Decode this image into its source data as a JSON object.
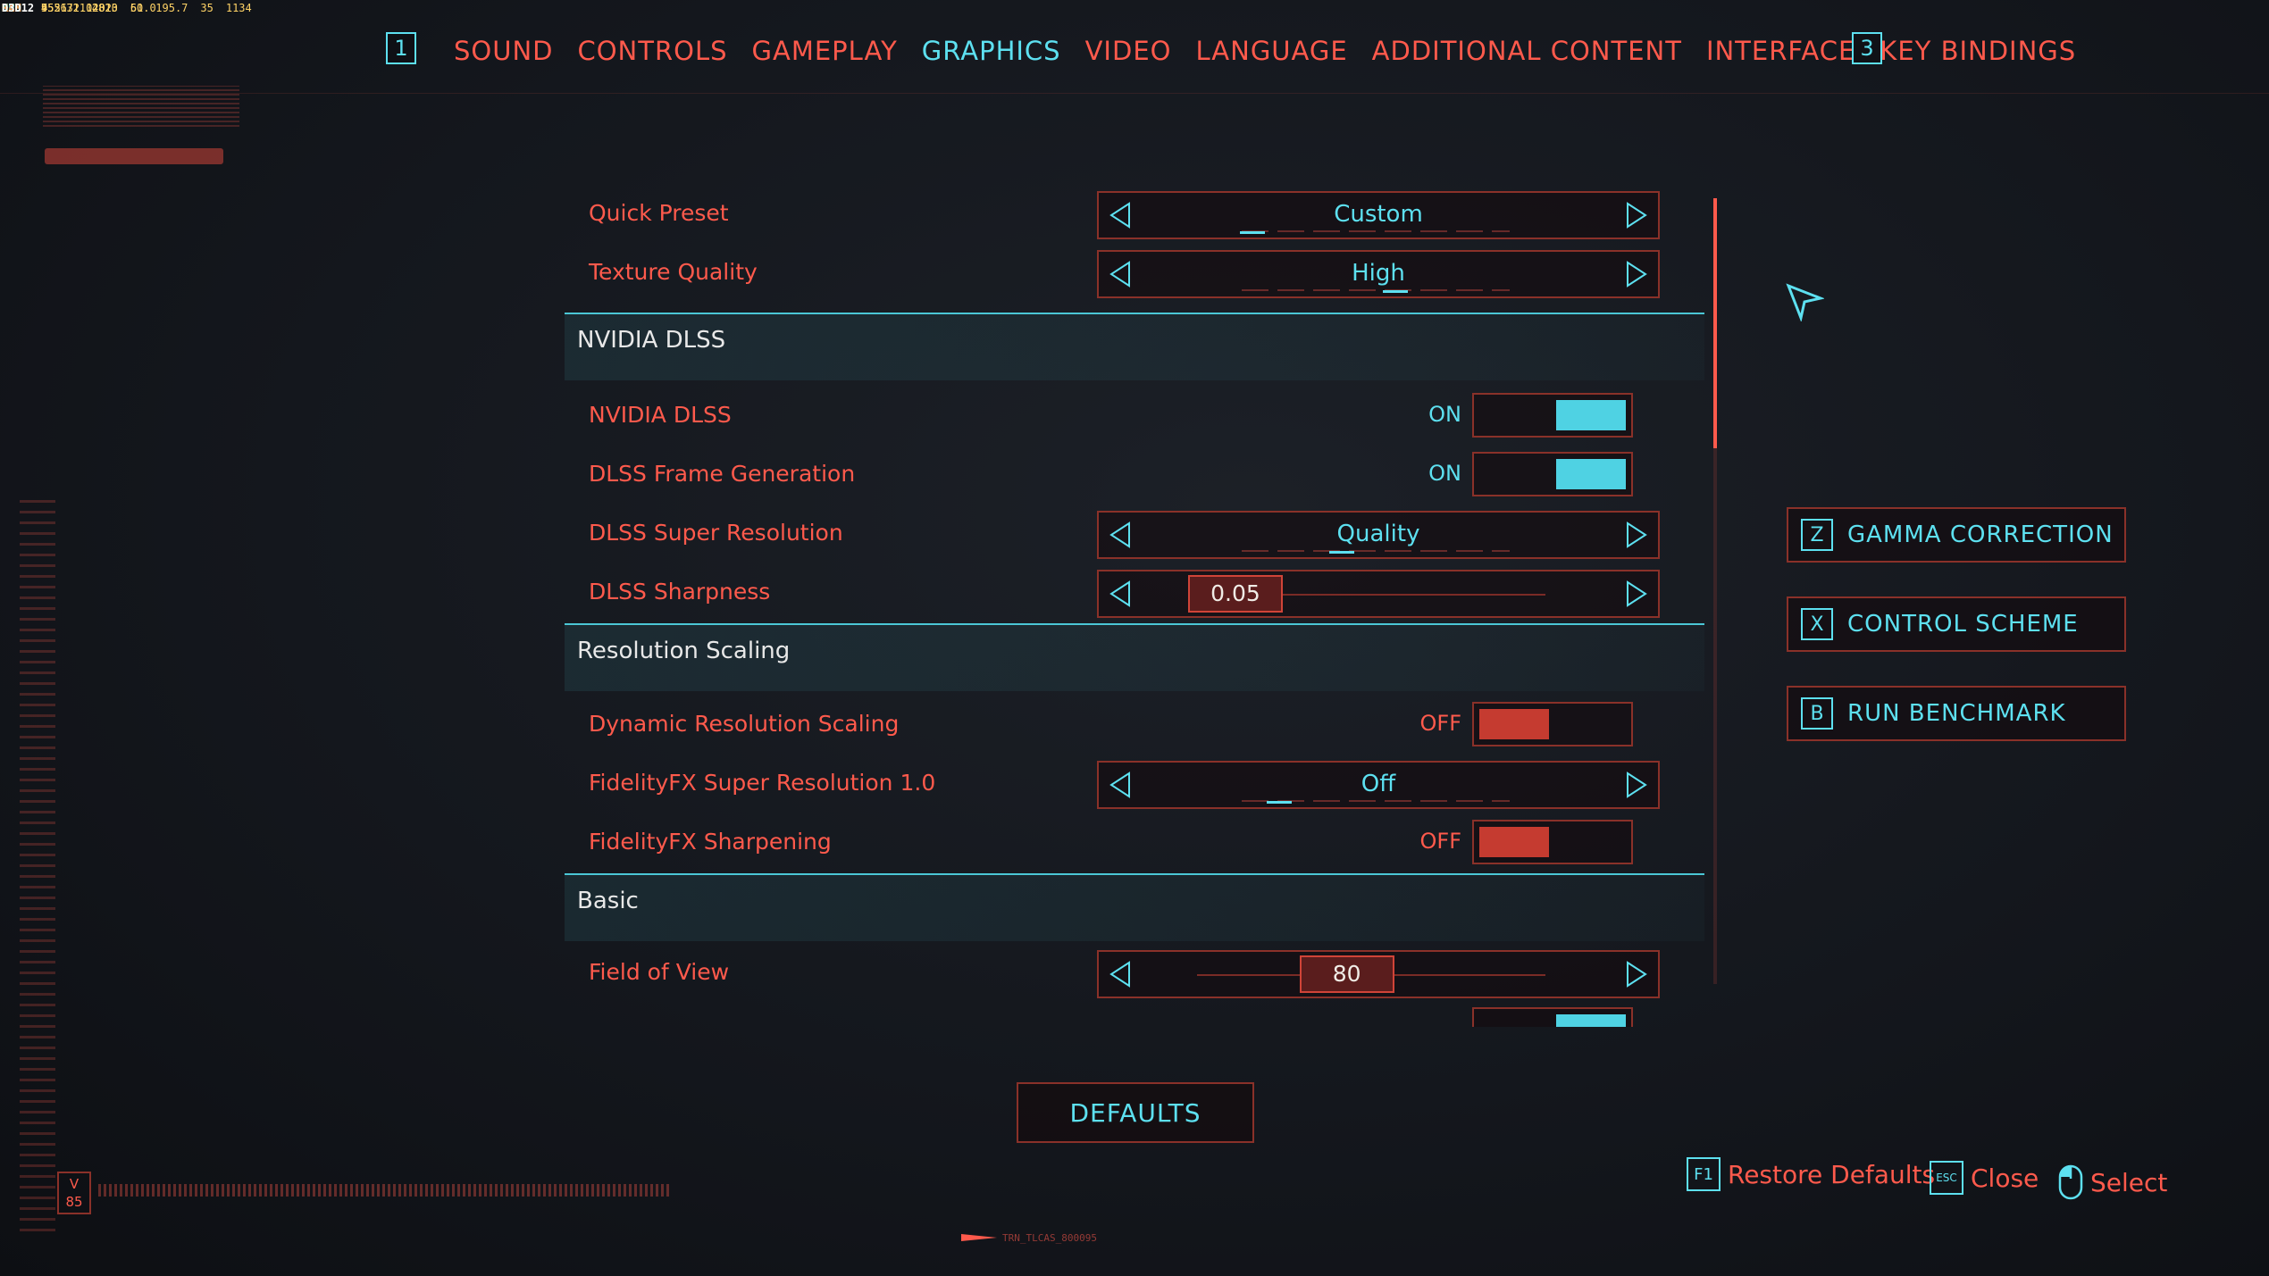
{
  "perf": [
    {
      "label": "GPU",
      "vals": [
        "55",
        "71",
        "2820",
        "60",
        "195.7",
        "35",
        "1134"
      ]
    },
    {
      "label": "MEM",
      "vals": [
        "9531",
        "11202"
      ]
    },
    {
      "label": "CPU",
      "vals": [
        "45",
        "32",
        "4813",
        "51.0"
      ]
    },
    {
      "label": "RAM",
      "vals": [
        "7526"
      ]
    },
    {
      "label": "D3D12",
      "vals": [
        "455",
        "2.0"
      ]
    }
  ],
  "nav": {
    "prev_key": "1",
    "next_key": "3",
    "tabs": [
      "SOUND",
      "CONTROLS",
      "GAMEPLAY",
      "GRAPHICS",
      "VIDEO",
      "LANGUAGE",
      "ADDITIONAL CONTENT",
      "INTERFACE",
      "KEY BINDINGS"
    ],
    "active_tab": "GRAPHICS"
  },
  "settings": {
    "quick_preset": {
      "label": "Quick Preset",
      "value": "Custom"
    },
    "texture_quality": {
      "label": "Texture Quality",
      "value": "High"
    },
    "section_dlss": "NVIDIA DLSS",
    "nvidia_dlss": {
      "label": "NVIDIA DLSS",
      "state": "ON"
    },
    "dlss_frame_gen": {
      "label": "DLSS Frame Generation",
      "state": "ON"
    },
    "dlss_super_res": {
      "label": "DLSS Super Resolution",
      "value": "Quality"
    },
    "dlss_sharpness": {
      "label": "DLSS Sharpness",
      "value": "0.05",
      "fraction": 0.05
    },
    "section_resolution": "Resolution Scaling",
    "dynamic_res": {
      "label": "Dynamic Resolution Scaling",
      "state": "OFF"
    },
    "fidelityfx_sr": {
      "label": "FidelityFX Super Resolution 1.0",
      "value": "Off"
    },
    "fidelityfx_sharp": {
      "label": "FidelityFX Sharpening",
      "state": "OFF"
    },
    "section_basic": "Basic",
    "fov": {
      "label": "Field of View",
      "value": "80",
      "fraction": 0.43
    }
  },
  "side_buttons": [
    {
      "key": "Z",
      "label": "GAMMA CORRECTION"
    },
    {
      "key": "X",
      "label": "CONTROL SCHEME"
    },
    {
      "key": "B",
      "label": "RUN BENCHMARK"
    }
  ],
  "defaults_label": "DEFAULTS",
  "hints": {
    "restore": {
      "key": "F1",
      "label": "Restore Defaults"
    },
    "close": {
      "key": "ESC",
      "label": "Close"
    },
    "select": {
      "label": "Select"
    }
  },
  "version_badge": "V 85",
  "bottom_code": "TRN_TLCAS_800095",
  "colors": {
    "accent": "#5de0f0",
    "primary": "#ff5a4c",
    "toggle_on": "#4fd2e3",
    "toggle_off": "#c53b30"
  }
}
